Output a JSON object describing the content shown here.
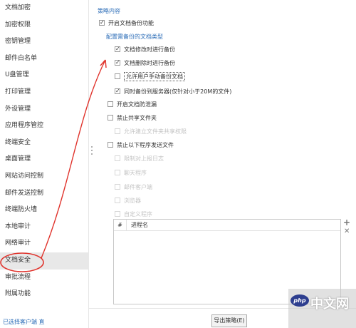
{
  "sidebar": {
    "items": [
      {
        "label": "文档加密"
      },
      {
        "label": "加密权限"
      },
      {
        "label": "密钥管理"
      },
      {
        "label": "邮件白名单"
      },
      {
        "label": "U盘管理"
      },
      {
        "label": "打印管理"
      },
      {
        "label": "外设管理"
      },
      {
        "label": "应用程序管控"
      },
      {
        "label": "终端安全"
      },
      {
        "label": "桌面管理"
      },
      {
        "label": "网站访问控制"
      },
      {
        "label": "邮件发送控制"
      },
      {
        "label": "终端防火墙"
      },
      {
        "label": "本地审计"
      },
      {
        "label": "网络审计"
      },
      {
        "label": "文档安全"
      },
      {
        "label": "审批流程"
      },
      {
        "label": "附属功能"
      }
    ],
    "active_index": 15,
    "footer_link": "已选择客户端 直"
  },
  "main": {
    "section_title": "策略内容",
    "options": {
      "enable_backup": {
        "label": "开启文档备份功能",
        "checked": true
      },
      "backup_type_title": "配置需备份的文档类型",
      "on_modify": {
        "label": "文档修改时进行备份",
        "checked": true
      },
      "on_delete": {
        "label": "文档删除时进行备份",
        "checked": true
      },
      "manual_backup": {
        "label": "允许用户手动备份文档",
        "checked": false
      },
      "sync_server": {
        "label": "同时备份到服务器(仅针对小于20M的文件)",
        "checked": true
      },
      "anti_copy": {
        "label": "开启文档防泄漏",
        "checked": false
      },
      "disable_share": {
        "label": "禁止共享文件夹",
        "checked": false
      },
      "allow_share_sub": {
        "label": "允许建立文件夹共享权限",
        "checked": false
      },
      "block_send": {
        "label": "禁止以下程序发送文件",
        "checked": false
      },
      "rule_a": {
        "label": "限制对上报日志",
        "checked": false
      },
      "rule_b": {
        "label": "聊天程序",
        "checked": false
      },
      "rule_c": {
        "label": "邮件客户端",
        "checked": false
      },
      "rule_d": {
        "label": "浏览器",
        "checked": false
      },
      "rule_e": {
        "label": "自定义程序",
        "checked": false
      }
    },
    "table": {
      "columns": [
        "#",
        "进程名"
      ],
      "rows": []
    },
    "add_icon": "+",
    "delete_icon": "✕",
    "export_button": "导出策略(E)"
  },
  "watermark": {
    "logo": "php",
    "text": "中文网"
  },
  "colors": {
    "accent_blue": "#2b6cb7",
    "annotation_red": "#e0322b",
    "active_bg": "#e8e8e8"
  }
}
